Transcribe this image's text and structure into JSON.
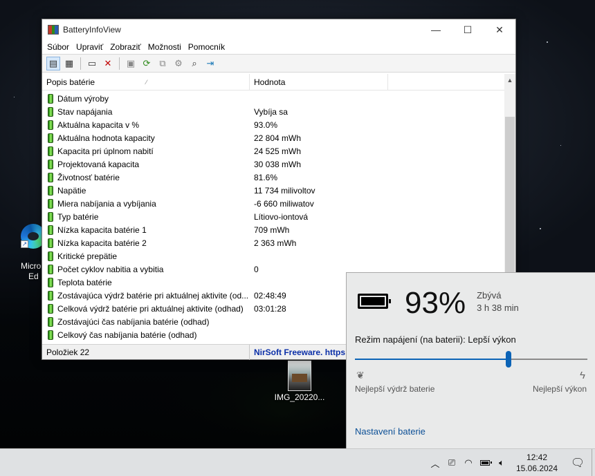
{
  "window": {
    "title": "BatteryInfoView",
    "controls": {
      "minimize": "—",
      "maximize": "☐",
      "close": "✕"
    }
  },
  "menu": [
    "Súbor",
    "Upraviť",
    "Zobraziť",
    "Možnosti",
    "Pomocník"
  ],
  "list": {
    "col_description": "Popis batérie",
    "col_value": "Hodnota",
    "rows": [
      {
        "label": "Dátum výroby",
        "value": ""
      },
      {
        "label": "Stav napájania",
        "value": "Vybíja sa"
      },
      {
        "label": "Aktuálna kapacita v %",
        "value": "93.0%"
      },
      {
        "label": "Aktuálna hodnota kapacity",
        "value": "22 804 mWh"
      },
      {
        "label": "Kapacita pri úplnom nabití",
        "value": "24 525 mWh"
      },
      {
        "label": "Projektovaná kapacita",
        "value": "30 038 mWh"
      },
      {
        "label": "Životnosť batérie",
        "value": "81.6%"
      },
      {
        "label": "Napätie",
        "value": "11 734 milivoltov"
      },
      {
        "label": "Miera nabíjania a vybíjania",
        "value": "-6 660 miliwatov"
      },
      {
        "label": "Typ batérie",
        "value": "Lítiovo-iontová"
      },
      {
        "label": "Nízka kapacita batérie 1",
        "value": "709 mWh"
      },
      {
        "label": "Nízka kapacita batérie 2",
        "value": "2 363 mWh"
      },
      {
        "label": "Kritické prepätie",
        "value": ""
      },
      {
        "label": "Počet cyklov nabitia a vybitia",
        "value": "0"
      },
      {
        "label": "Teplota batérie",
        "value": ""
      },
      {
        "label": "Zostávajúca výdrž batérie pri aktuálnej aktivite (od...",
        "value": "02:48:49"
      },
      {
        "label": "Celková výdrž batérie pri aktuálnej aktivite (odhad)",
        "value": "03:01:28"
      },
      {
        "label": "Zostávajúci čas nabíjania batérie (odhad)",
        "value": ""
      },
      {
        "label": "Celkový čas nabíjania batérie (odhad)",
        "value": ""
      }
    ]
  },
  "status": {
    "count": "Položiek 22",
    "link": "NirSoft Freeware. https://www.nirsoft.net"
  },
  "flyout": {
    "percent": "93%",
    "remaining_label": "Zbývá",
    "remaining_time": "3 h 38 min",
    "power_mode": "Režim napájení (na baterii): Lepší výkon",
    "slider_level": 0.66,
    "left_label": "Nejlepší výdrž baterie",
    "right_label": "Nejlepší výkon",
    "settings_link": "Nastavení baterie"
  },
  "desktop": {
    "edge_label_1": "Micro",
    "edge_label_2": "Ed",
    "image_label": "IMG_20220..."
  },
  "taskbar": {
    "time": "12:42",
    "date": "15.06.2024"
  },
  "colors": {
    "accent": "#0b63b6",
    "link": "#0b2fa8",
    "battery_green": "#5fd33a"
  }
}
